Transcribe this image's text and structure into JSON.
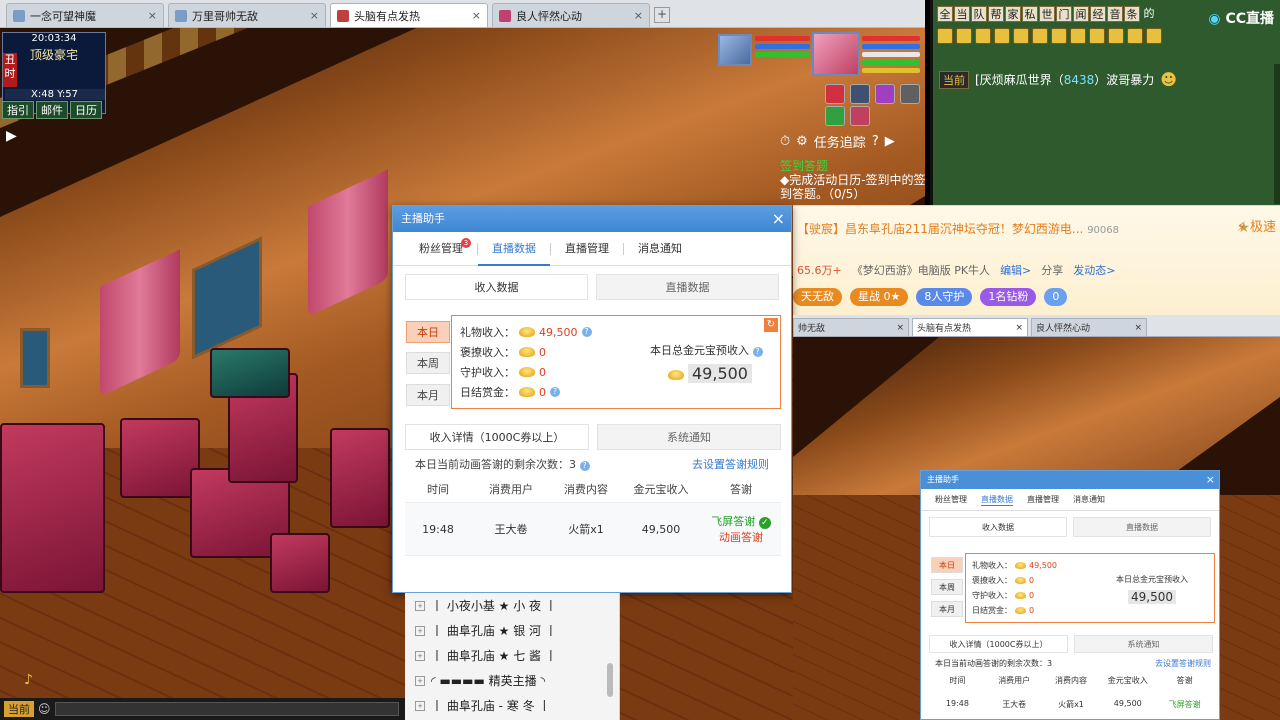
{
  "browser": {
    "tabs": [
      {
        "label": "一念可望神魔",
        "active": false
      },
      {
        "label": "万里哥帅无敌",
        "active": false
      },
      {
        "label": "头脑有点发热",
        "active": true
      },
      {
        "label": "良人怦然心动",
        "active": false
      }
    ],
    "close_glyph": "×",
    "new_tab_glyph": "+"
  },
  "game_hud": {
    "time": "20:03:34",
    "location": "顶级豪宅",
    "coords": "X:48  Y:57",
    "side_label": "丑时",
    "buttons": [
      "指引",
      "邮件",
      "日历"
    ],
    "quest_tracking": "任务追踪",
    "quest_title": "签到答题",
    "quest_desc": "◆完成活动日历-签到中的签到答题。（0/5）",
    "chat_current": "当前",
    "help": "?"
  },
  "chat": {
    "tabs": [
      "全",
      "当",
      "队",
      "帮",
      "家",
      "私",
      "世",
      "门",
      "闻",
      "经",
      "音",
      "条"
    ],
    "trailing_text": "的",
    "logo": "CC直播",
    "message": {
      "channel": "当前",
      "prefix": "[厌烦麻瓜世界（",
      "number": "8438",
      "suffix": "）波哥暴力"
    }
  },
  "stream_info": {
    "title": "【驶宸】昌东阜孔庙211届沉神坛夺冠！梦幻西游电...",
    "room_id": "90068",
    "hot": "65.6万+",
    "category": "《梦幻西游》电脑版 PK牛人",
    "edit": "编辑>",
    "share": "分享",
    "dynamic": "发动态>",
    "badges": {
      "left": "天无敌",
      "level": "星战",
      "level_num": "0",
      "guard": "8人守护",
      "diamond": "1名钻粉",
      "fans": "0"
    },
    "quick": "极速"
  },
  "assistant": {
    "title": "主播助手",
    "tabs": [
      {
        "label": "粉丝管理",
        "badge": "3",
        "active": false
      },
      {
        "label": "直播数据",
        "active": true
      },
      {
        "label": "直播管理",
        "active": false
      },
      {
        "label": "消息通知",
        "active": false
      }
    ],
    "subtabs": [
      {
        "label": "收入数据",
        "active": true
      },
      {
        "label": "直播数据",
        "active": false
      }
    ],
    "periods": [
      {
        "label": "本日",
        "active": true
      },
      {
        "label": "本周",
        "active": false
      },
      {
        "label": "本月",
        "active": false
      }
    ],
    "income": {
      "gift_label": "礼物收入：",
      "gift_value": "49,500",
      "tease_label": "褒撩收入：",
      "tease_value": "0",
      "guard_label": "守护收入：",
      "guard_value": "0",
      "daily_label": "日结赏金：",
      "daily_value": "0",
      "total_label": "本日总金元宝预收入",
      "total_value": "49,500"
    },
    "detail_tabs": [
      {
        "label": "收入详情（1000C券以上）",
        "active": true
      },
      {
        "label": "系统通知",
        "active": false
      }
    ],
    "remain_text": "本日当前动画答谢的剩余次数：",
    "remain_value": "3",
    "set_rule": "去设置答谢规则",
    "table": {
      "headers": [
        "时间",
        "消费用户",
        "消费内容",
        "金元宝收入",
        "答谢"
      ],
      "rows": [
        {
          "time": "19:48",
          "user": "王大卷",
          "content": "火箭x1",
          "income": "49,500",
          "thank_a": "飞屏答谢",
          "thank_b": "动画答谢"
        }
      ]
    }
  },
  "ranklist": [
    "丨 小夜小基 ★ 小 夜 丨",
    "丨 曲阜孔庙 ★ 银 河 丨",
    "丨 曲阜孔庙 ★ 七 酱 丨",
    "◜ ▬▬▬▬ 精英主播 ◝",
    "丨 曲阜孔庙 - 寒   冬 丨"
  ],
  "mini_view": {
    "tabs": [
      {
        "label": "帅无敌",
        "active": false
      },
      {
        "label": "头脑有点发热",
        "active": true
      },
      {
        "label": "良人怦然心动",
        "active": false
      }
    ],
    "title": "主播助手",
    "tabs2": [
      "粉丝管理",
      "直播数据",
      "直播管理",
      "消息通知"
    ],
    "sub": [
      "收入数据",
      "直播数据"
    ],
    "periods": [
      "本日",
      "本周",
      "本月"
    ],
    "rows": [
      {
        "l": "礼物收入：",
        "v": "49,500"
      },
      {
        "l": "褒撩收入：",
        "v": "0"
      },
      {
        "l": "守护收入：",
        "v": "0"
      },
      {
        "l": "日结赏金：",
        "v": "0"
      }
    ],
    "total_label": "本日总金元宝预收入",
    "total_value": "49,500",
    "detail": [
      "收入详情（1000C券以上）",
      "系统通知"
    ],
    "remain": "本日当前动画答谢的剩余次数：3",
    "rule": "去设置答谢规则",
    "headers": [
      "时间",
      "消费用户",
      "消费内容",
      "金元宝收入",
      "答谢"
    ],
    "row": [
      "19:48",
      "王大卷",
      "火箭x1",
      "49,500",
      "飞屏答谢"
    ]
  },
  "colors": {
    "accent_blue": "#3a7ad0",
    "accent_orange": "#f08040",
    "income_red": "#e04020"
  }
}
